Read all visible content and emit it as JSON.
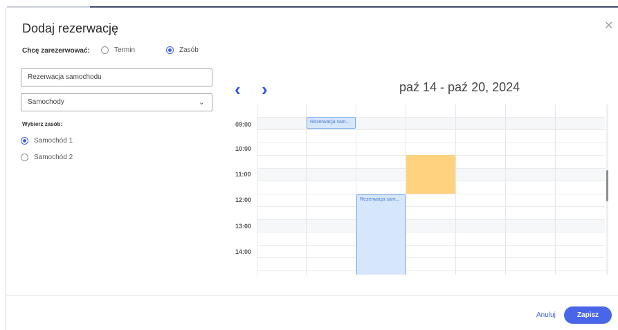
{
  "dialog": {
    "title": "Dodaj rezerwację"
  },
  "booking_type": {
    "label": "Chcę zarezerwować:",
    "options": [
      {
        "label": "Termin",
        "checked": false
      },
      {
        "label": "Zasób",
        "checked": true
      }
    ]
  },
  "form": {
    "name_value": "Rezerwacja samochodu",
    "category_value": "Samochody",
    "resource_label": "Wybierz zasób:",
    "resources": [
      {
        "label": "Samochód 1",
        "checked": true
      },
      {
        "label": "Samochód 2",
        "checked": false
      }
    ]
  },
  "calendar": {
    "range": "paź 14 - paź 20, 2024",
    "hours": [
      "09:00",
      "10:00",
      "11:00",
      "12:00",
      "13:00",
      "14:00"
    ],
    "events": [
      {
        "title": "Rezerwacja sam...",
        "day_index": 1,
        "start": "09:00",
        "end": "09:30"
      },
      {
        "title": "Rezerwacja sam...",
        "day_index": 2,
        "start": "12:00",
        "end": "15:00"
      }
    ],
    "blocked": [
      {
        "day_index": 3,
        "start": "10:30",
        "end": "12:00",
        "color": "#ffd27f"
      }
    ]
  },
  "footer": {
    "cancel_label": "Anuluj",
    "save_label": "Zapisz"
  },
  "colors": {
    "accent": "#3d5fe0",
    "event_bg": "#d6e6fb",
    "blocked": "#ffd27f"
  }
}
